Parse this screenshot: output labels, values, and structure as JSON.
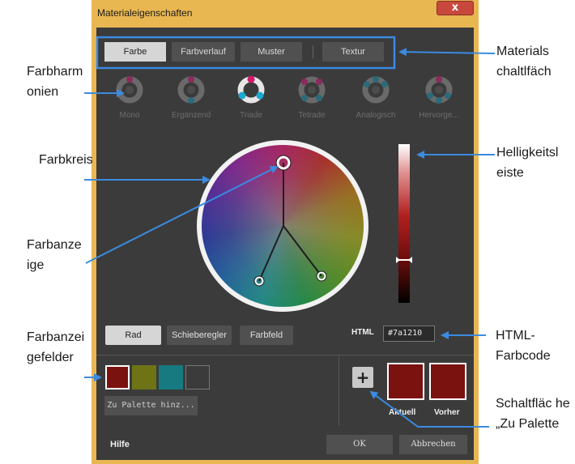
{
  "window": {
    "title": "Materialeigenschaften",
    "close_label": "x"
  },
  "tabs": [
    {
      "label": "Farbe",
      "active": true
    },
    {
      "label": "Farbverlauf",
      "active": false
    },
    {
      "label": "Muster",
      "active": false
    },
    {
      "label": "Textur",
      "active": false
    }
  ],
  "harmonies": [
    {
      "label": "Mono",
      "icon": "mono-harmony-icon",
      "active": false
    },
    {
      "label": "Ergänzend",
      "icon": "complementary-harmony-icon",
      "active": false
    },
    {
      "label": "Triade",
      "icon": "triad-harmony-icon",
      "active": true
    },
    {
      "label": "Tetrade",
      "icon": "tetrad-harmony-icon",
      "active": false
    },
    {
      "label": "Analogisch",
      "icon": "analogous-harmony-icon",
      "active": false
    },
    {
      "label": "Hervorge...",
      "icon": "accent-harmony-icon",
      "active": false
    }
  ],
  "modes": [
    {
      "label": "Rad",
      "active": true
    },
    {
      "label": "Schieberegler",
      "active": false
    },
    {
      "label": "Farbfeld",
      "active": false
    }
  ],
  "html_code": {
    "label": "HTML",
    "value": "#7a1210"
  },
  "swatches": [
    {
      "color": "#7a1210",
      "selected": true
    },
    {
      "color": "#6e7416",
      "selected": false
    },
    {
      "color": "#167a80",
      "selected": false
    },
    {
      "color": "",
      "selected": false
    }
  ],
  "add_to_palette_label": "Zu Palette hinz...",
  "plus_label": "+",
  "current": {
    "label": "Aktuell",
    "color": "#7a1210"
  },
  "previous": {
    "label": "Vorher",
    "color": "#7a1210"
  },
  "footer": {
    "help": "Hilfe",
    "ok": "OK",
    "cancel": "Abbrechen"
  },
  "colors": {
    "accent": "#3b8be0",
    "panel": "#3b3b3b",
    "frame": "#e9b752"
  },
  "annotations": {
    "materials": "Materials chaltlfäch",
    "harmonies": "Farbharm onien",
    "wheel": "Farbkreis",
    "color_indicator": "Farbanze ige",
    "brightness": "Helligkeitsl eiste",
    "swatches": "Farbanzei gefelder",
    "html": "HTML-Farbcode",
    "palette_button": "Schaltfläc he „Zu Palette"
  }
}
